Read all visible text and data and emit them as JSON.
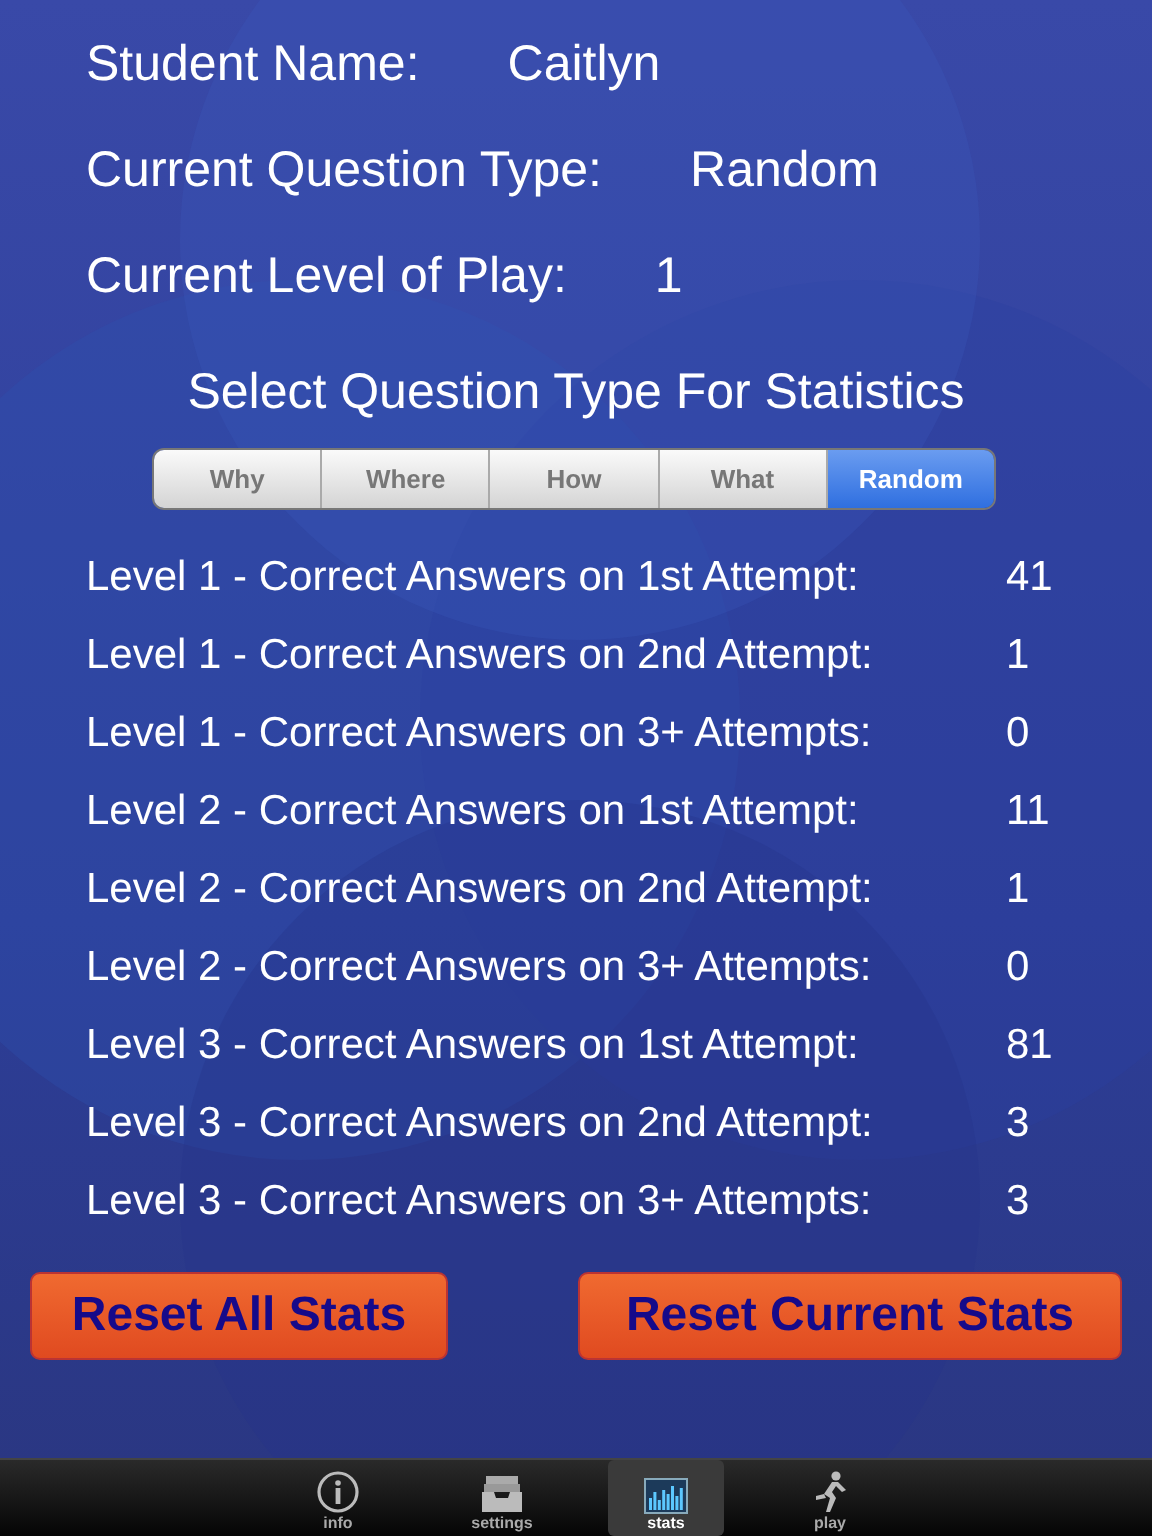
{
  "info": [
    {
      "label": "Student Name:",
      "value": "Caitlyn"
    },
    {
      "label": "Current Question Type:",
      "value": "Random"
    },
    {
      "label": "Current Level of Play:",
      "value": "1"
    }
  ],
  "heading": "Select Question Type For Statistics",
  "segments": [
    {
      "label": "Why",
      "selected": false
    },
    {
      "label": "Where",
      "selected": false
    },
    {
      "label": "How",
      "selected": false
    },
    {
      "label": "What",
      "selected": false
    },
    {
      "label": "Random",
      "selected": true
    }
  ],
  "stats": [
    {
      "label": "Level 1 - Correct Answers on 1st Attempt:",
      "value": "41"
    },
    {
      "label": "Level 1 - Correct Answers on 2nd Attempt:",
      "value": "1"
    },
    {
      "label": "Level 1 - Correct Answers on 3+ Attempts:",
      "value": "0"
    },
    {
      "label": "Level 2 - Correct Answers on 1st Attempt:",
      "value": "11"
    },
    {
      "label": "Level 2 - Correct Answers on 2nd Attempt:",
      "value": "1"
    },
    {
      "label": "Level 2 - Correct Answers on 3+ Attempts:",
      "value": "0"
    },
    {
      "label": "Level 3 - Correct Answers on 1st Attempt:",
      "value": "81"
    },
    {
      "label": "Level 3 - Correct Answers on 2nd Attempt:",
      "value": "3"
    },
    {
      "label": "Level 3 - Correct Answers on 3+ Attempts:",
      "value": "3"
    }
  ],
  "buttons": [
    "Reset All Stats",
    "Reset Current Stats"
  ],
  "tab_bar": [
    {
      "label": "info",
      "kind": "info",
      "selected": false
    },
    {
      "label": "settings",
      "kind": "settings",
      "selected": false
    },
    {
      "label": "stats",
      "kind": "stats",
      "selected": true
    },
    {
      "label": "play",
      "kind": "play",
      "selected": false
    }
  ]
}
